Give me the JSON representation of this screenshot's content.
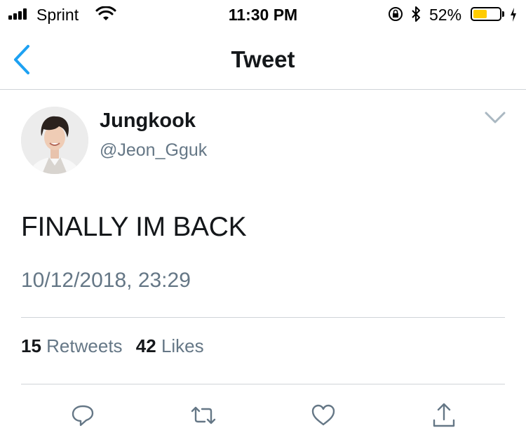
{
  "status_bar": {
    "carrier": "Sprint",
    "time": "11:30 PM",
    "battery_percent": "52%",
    "battery_level": 0.52,
    "battery_color": "#ffcc00"
  },
  "nav": {
    "title": "Tweet",
    "back_icon": "chevron-left-icon",
    "accent": "#1da1f2"
  },
  "tweet": {
    "author": {
      "name": "Jungkook",
      "handle": "@Jeon_Gguk"
    },
    "text": "FINALLY IM BACK",
    "timestamp": "10/12/2018, 23:29",
    "stats": {
      "retweets_count": "15",
      "retweets_label": "Retweets",
      "likes_count": "42",
      "likes_label": "Likes"
    },
    "actions": [
      "reply-icon",
      "retweet-icon",
      "like-icon",
      "share-icon"
    ]
  }
}
